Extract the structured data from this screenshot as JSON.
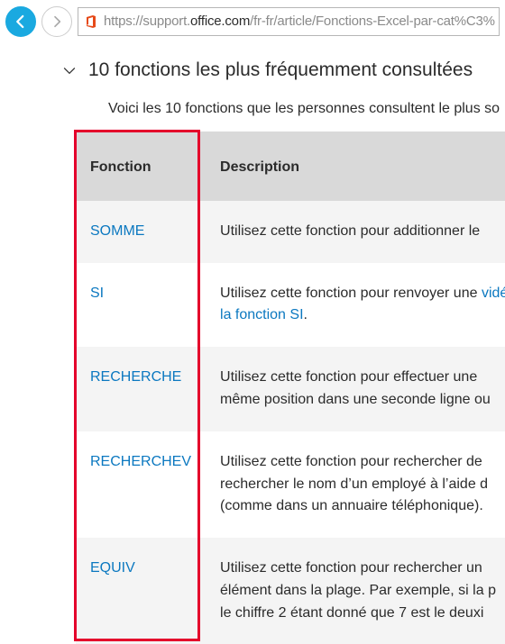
{
  "browser": {
    "url_prefix": "https://support.",
    "url_domain": "office.com",
    "url_path": "/fr-fr/article/Fonctions-Excel-par-cat%C3%"
  },
  "page": {
    "heading": "10 fonctions les plus fréquemment consultées",
    "intro": "Voici les 10 fonctions que les personnes consultent le plus so"
  },
  "table": {
    "headers": {
      "func": "Fonction",
      "desc": "Description"
    },
    "rows": [
      {
        "func": "SOMME",
        "desc_pre": "Utilisez cette fonction pour additionner le",
        "link": "",
        "desc_post": ""
      },
      {
        "func": "SI",
        "desc_pre": "Utilisez cette fonction pour renvoyer une ",
        "link": "vidéo sur l’utilisation de la fonction SI",
        "desc_post": "."
      },
      {
        "func": "RECHERCHE",
        "desc_pre": "Utilisez cette fonction pour effectuer une \nmême position dans une seconde ligne ou",
        "link": "",
        "desc_post": ""
      },
      {
        "func": "RECHERCHEV",
        "desc_pre": "Utilisez cette fonction pour rechercher de\nrechercher le nom d’un employé à l’aide d\n(comme dans un annuaire téléphonique).",
        "link": "",
        "desc_post": ""
      },
      {
        "func": "EQUIV",
        "desc_pre": "Utilisez cette fonction pour rechercher un\nélément dans la plage. Par exemple, si la p\nle chiffre 2 étant donné que 7 est le deuxi",
        "link": "",
        "desc_post": ""
      }
    ]
  }
}
